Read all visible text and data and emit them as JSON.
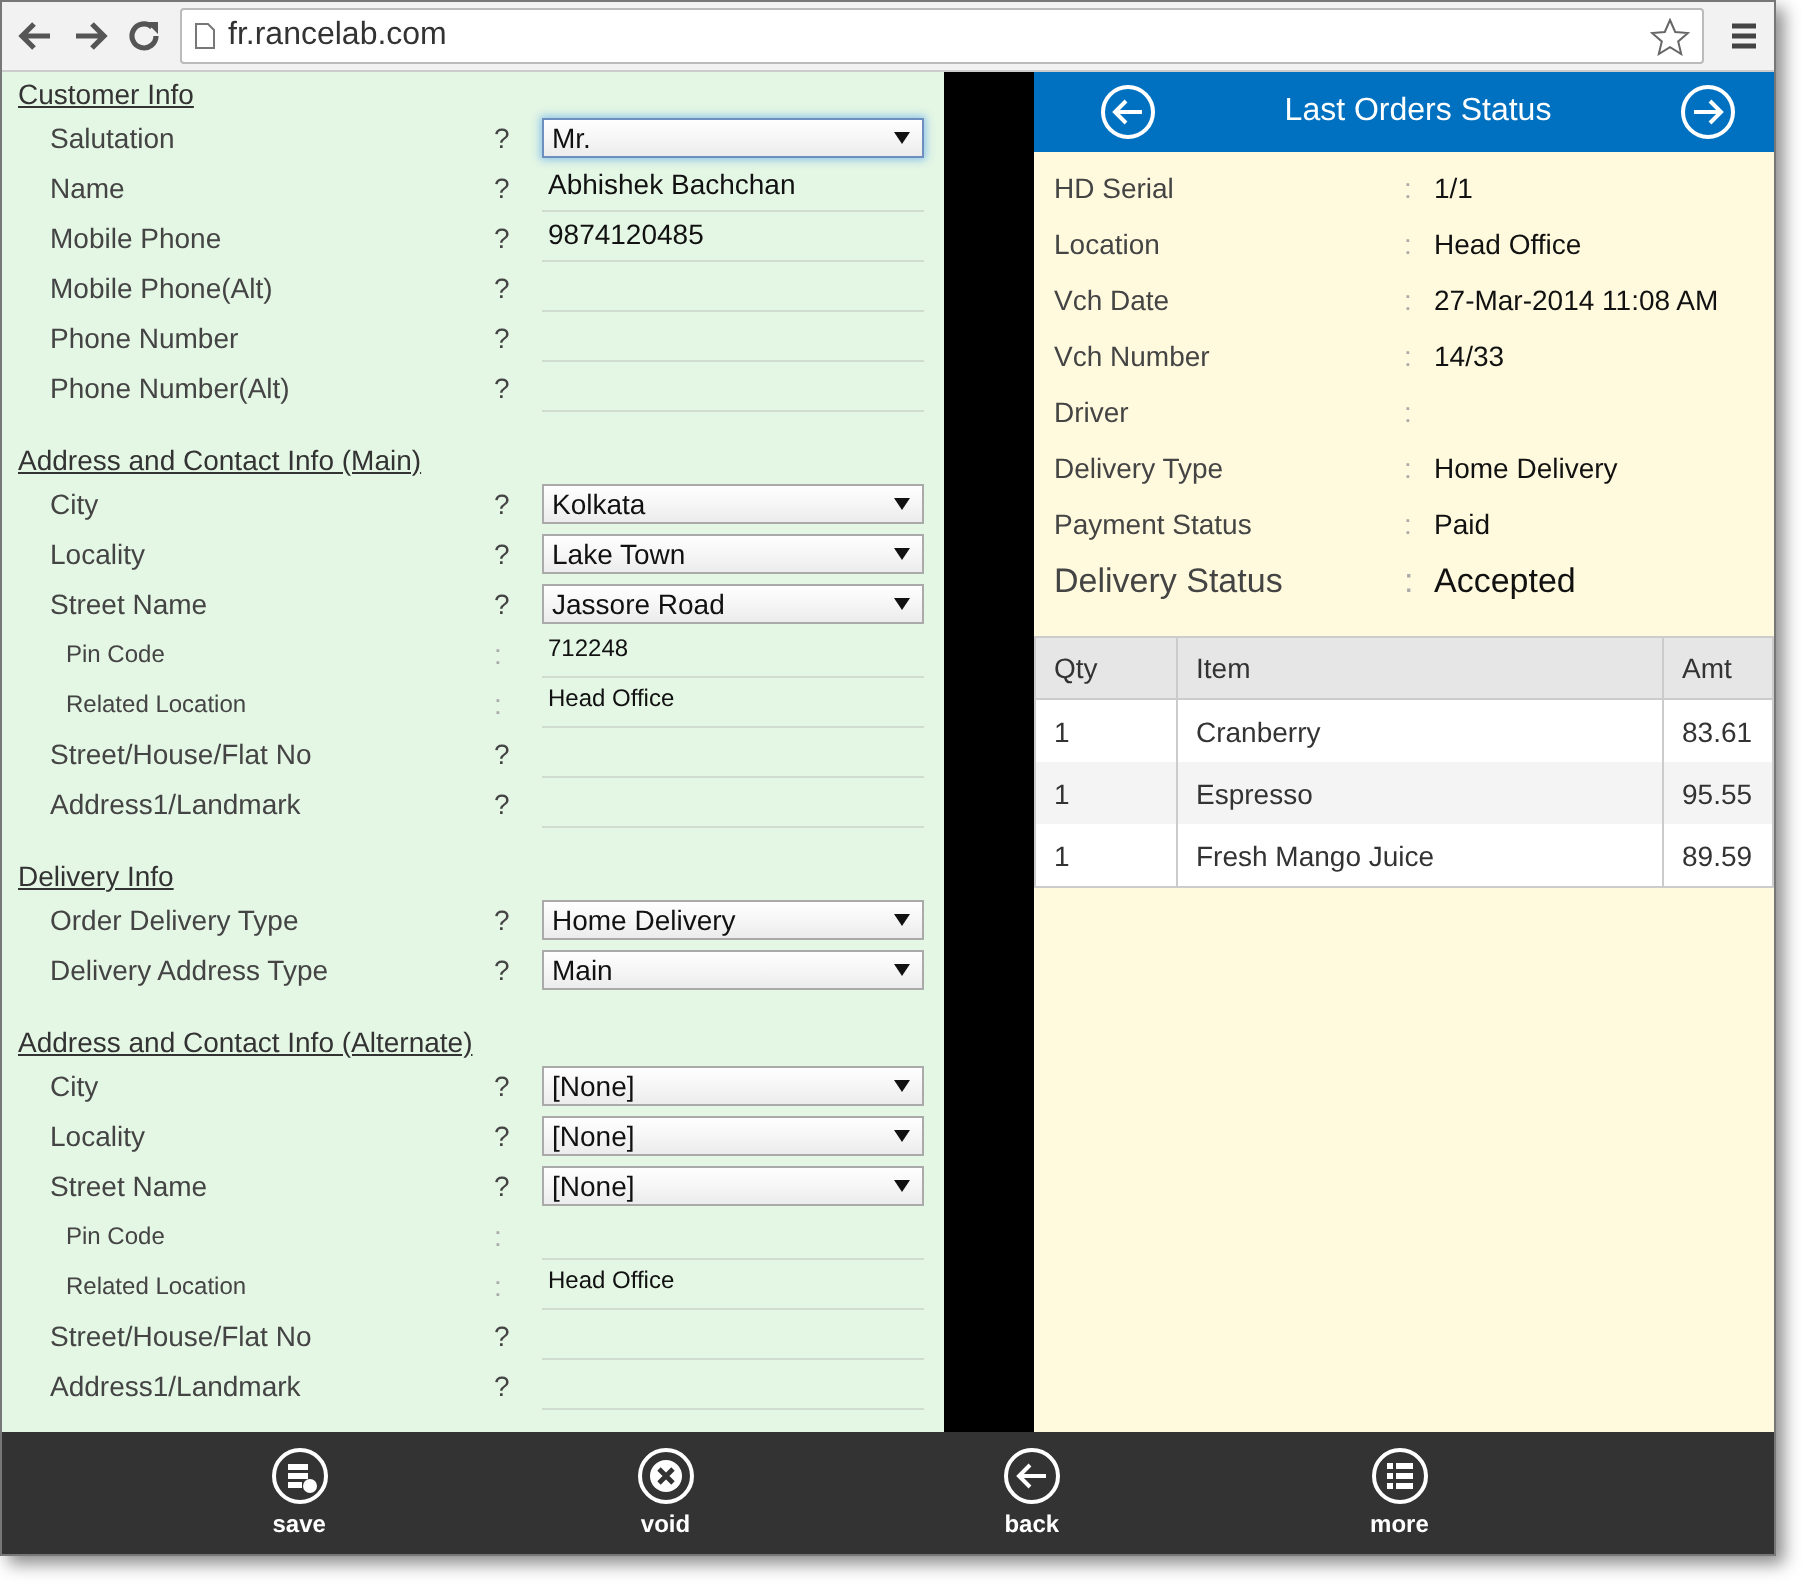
{
  "browser": {
    "url": "fr.rancelab.com"
  },
  "form": {
    "sections": [
      {
        "title": "Customer Info",
        "rows": [
          {
            "kind": "select",
            "label": "Salutation",
            "mark": "?",
            "value": "Mr.",
            "focused": true
          },
          {
            "kind": "input",
            "label": "Name",
            "mark": "?",
            "value": "Abhishek Bachchan"
          },
          {
            "kind": "input",
            "label": "Mobile Phone",
            "mark": "?",
            "value": "9874120485"
          },
          {
            "kind": "input",
            "label": "Mobile Phone(Alt)",
            "mark": "?"
          },
          {
            "kind": "input",
            "label": "Phone Number",
            "mark": "?"
          },
          {
            "kind": "input",
            "label": "Phone Number(Alt)",
            "mark": "?"
          }
        ]
      },
      {
        "title": "Address and Contact Info (Main)",
        "rows": [
          {
            "kind": "select",
            "label": "City",
            "mark": "?",
            "value": "Kolkata",
            "focused": false
          },
          {
            "kind": "select",
            "label": "Locality",
            "mark": "?",
            "value": "Lake Town",
            "focused": false
          },
          {
            "kind": "select",
            "label": "Street Name",
            "mark": "?",
            "value": "Jassore Road",
            "focused": false
          },
          {
            "kind": "info",
            "label": "Pin Code",
            "mark": ":",
            "value": "712248"
          },
          {
            "kind": "info",
            "label": "Related Location",
            "mark": ":",
            "value": "Head Office"
          },
          {
            "kind": "input",
            "label": "Street/House/Flat No",
            "mark": "?"
          },
          {
            "kind": "input",
            "label": "Address1/Landmark",
            "mark": "?"
          }
        ]
      },
      {
        "title": "Delivery Info",
        "rows": [
          {
            "kind": "select",
            "label": "Order Delivery Type",
            "mark": "?",
            "value": "Home Delivery",
            "focused": false
          },
          {
            "kind": "select",
            "label": "Delivery Address Type",
            "mark": "?",
            "value": "Main",
            "focused": false
          }
        ]
      },
      {
        "title": "Address and Contact Info (Alternate)",
        "rows": [
          {
            "kind": "select",
            "label": "City",
            "mark": "?",
            "value": "[None]",
            "focused": false
          },
          {
            "kind": "select",
            "label": "Locality",
            "mark": "?",
            "value": "[None]",
            "focused": false
          },
          {
            "kind": "select",
            "label": "Street Name",
            "mark": "?",
            "value": "[None]",
            "focused": false
          },
          {
            "kind": "info",
            "label": "Pin Code",
            "mark": ":"
          },
          {
            "kind": "info",
            "label": "Related Location",
            "mark": ":",
            "value": "Head Office"
          },
          {
            "kind": "input",
            "label": "Street/House/Flat No",
            "mark": "?"
          },
          {
            "kind": "input",
            "label": "Address1/Landmark",
            "mark": "?"
          }
        ]
      }
    ]
  },
  "order_status": {
    "title": "Last Orders Status",
    "details": [
      {
        "label": "HD Serial",
        "sep": ":",
        "value": "1/1"
      },
      {
        "label": "Location",
        "sep": ":",
        "value": "Head Office"
      },
      {
        "label": "Vch Date",
        "sep": ":",
        "value": "27-Mar-2014 11:08 AM"
      },
      {
        "label": "Vch Number",
        "sep": ":",
        "value": "14/33"
      },
      {
        "label": "Driver",
        "sep": ":"
      },
      {
        "label": "Delivery Type",
        "sep": ":",
        "value": "Home Delivery"
      },
      {
        "label": "Payment Status",
        "sep": ":",
        "value": "Paid"
      }
    ],
    "status": {
      "label": "Delivery Status",
      "sep": ":",
      "value": "Accepted"
    },
    "table": {
      "columns": [
        "Qty",
        "Item",
        "Amt"
      ],
      "rows": [
        [
          "1",
          "Cranberry",
          "83.61"
        ],
        [
          "1",
          "Espresso",
          "95.55"
        ],
        [
          "1",
          "Fresh Mango Juice",
          "89.59"
        ]
      ]
    }
  },
  "toolbar": [
    {
      "kind": "save",
      "label": "save"
    },
    {
      "kind": "void",
      "label": "void"
    },
    {
      "kind": "back",
      "label": "back"
    },
    {
      "kind": "more",
      "label": "more"
    }
  ]
}
